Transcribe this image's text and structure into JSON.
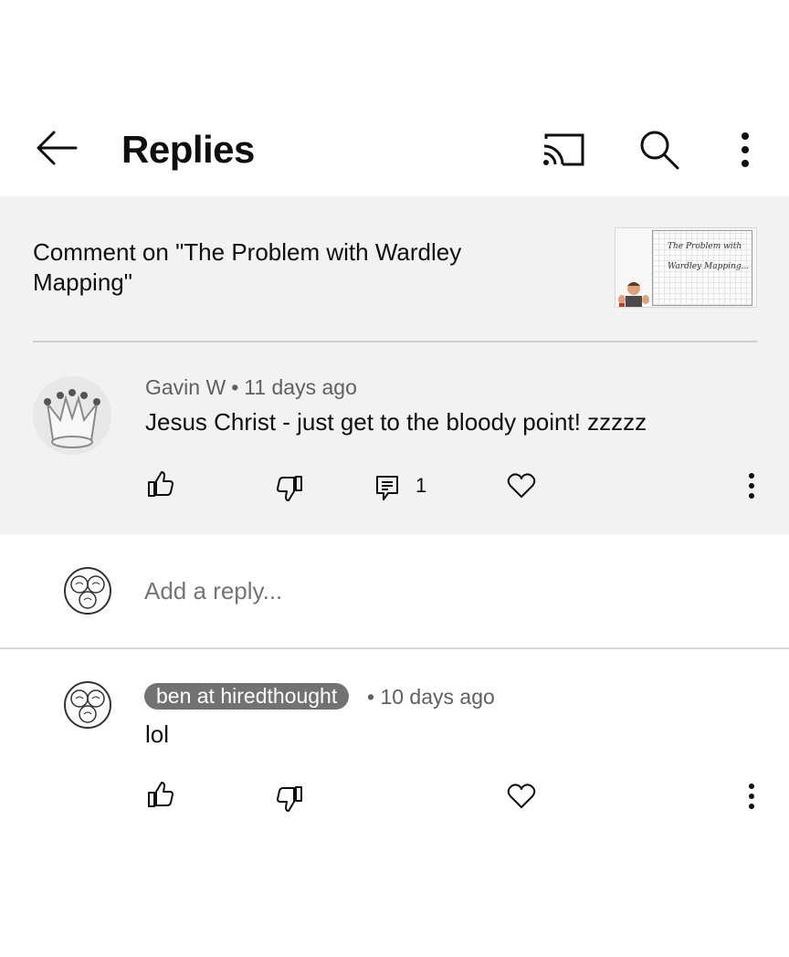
{
  "header": {
    "title": "Replies",
    "icons": [
      "back-arrow-icon",
      "cast-icon",
      "search-icon",
      "more-vert-icon"
    ]
  },
  "context": {
    "text": "Comment on \"The Problem with Wardley Mapping\"",
    "thumbnail_board_line1": "The Problem with",
    "thumbnail_board_line2": "Wardley Mapping..."
  },
  "comment": {
    "author": "Gavin W",
    "separator": "•",
    "time": "11 days ago",
    "text": "Jesus Christ - just get to the bloody point! zzzzz",
    "reply_count": "1",
    "actions": [
      "like-icon",
      "dislike-icon",
      "reply-icon",
      "heart-icon",
      "more-vert-icon"
    ]
  },
  "add_reply": {
    "placeholder": "Add a reply..."
  },
  "replies": [
    {
      "author": "ben at hiredthought",
      "separator": "•",
      "time": "10 days ago",
      "text": "lol",
      "actions": [
        "like-icon",
        "dislike-icon",
        "heart-icon",
        "more-vert-icon"
      ]
    }
  ],
  "colors": {
    "highlight_bg": "#f2f2f2",
    "secondary_text": "#606060",
    "author_chip_bg": "#727272",
    "primary_text": "#0f0f0f"
  }
}
